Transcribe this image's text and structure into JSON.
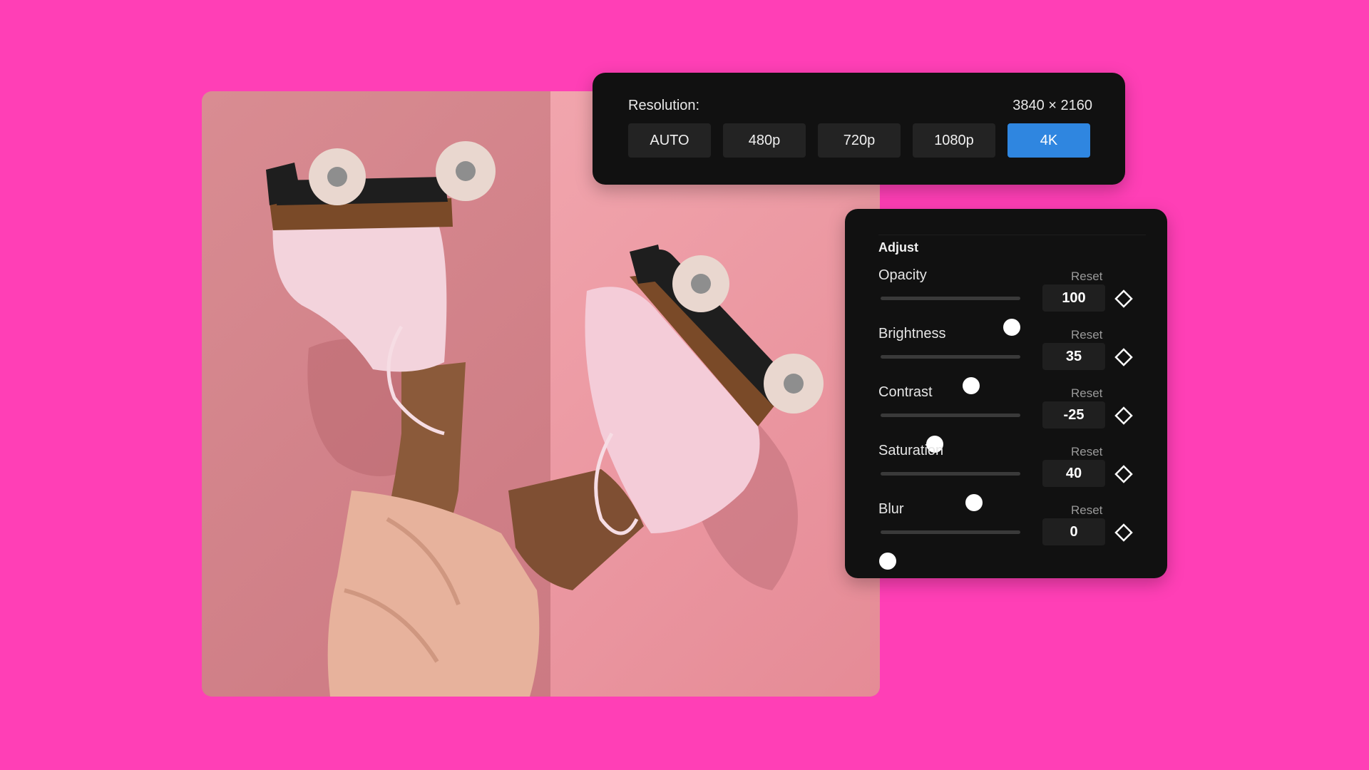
{
  "resolution": {
    "label": "Resolution:",
    "value": "3840 × 2160",
    "options": [
      "AUTO",
      "480p",
      "720p",
      "1080p",
      "4K"
    ],
    "selected": "4K",
    "accent_color": "#2f86e0"
  },
  "adjust": {
    "title": "Adjust",
    "reset_label": "Reset",
    "controls": [
      {
        "name": "Opacity",
        "value": "100",
        "slider_fraction": 0.94
      },
      {
        "name": "Brightness",
        "value": "35",
        "slider_fraction": 0.65
      },
      {
        "name": "Contrast",
        "value": "-25",
        "slider_fraction": 0.39
      },
      {
        "name": "Saturation",
        "value": "40",
        "slider_fraction": 0.67
      },
      {
        "name": "Blur",
        "value": "0",
        "slider_fraction": 0.05
      }
    ],
    "keyframe_icon": "diamond-icon"
  },
  "colors": {
    "background": "#ff3fb6",
    "panel": "#111111"
  }
}
